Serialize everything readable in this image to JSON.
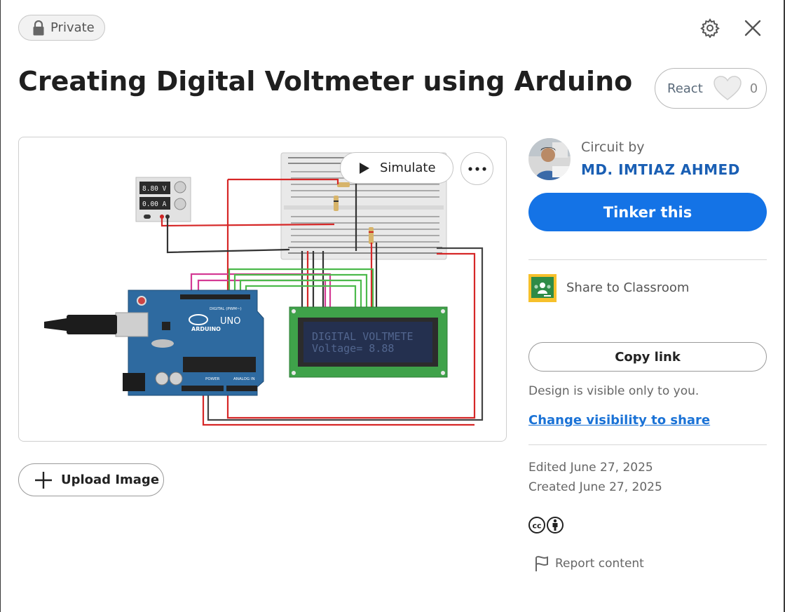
{
  "visibility_badge": {
    "label": "Private",
    "icon": "lock-icon"
  },
  "header": {
    "settings_icon": "gear-icon",
    "close_icon": "close-icon"
  },
  "design": {
    "title": "Creating Digital Voltmeter using Arduino",
    "react": {
      "label": "React",
      "count": "0",
      "icon": "heart-icon"
    }
  },
  "preview": {
    "simulate_label": "Simulate",
    "more_icon": "more-options-icon",
    "power_supply": {
      "voltage": "8.80 V",
      "current": "0.00 A"
    },
    "lcd": {
      "line1": "DIGITAL VOLTMETE",
      "line2": "Voltage= 8.88"
    },
    "arduino": {
      "brand": "ARDUINO",
      "model": "UNO",
      "digital_label": "DIGITAL (PWM~)",
      "power_label": "POWER",
      "analog_label": "ANALOG IN"
    }
  },
  "upload": {
    "label": "Upload Image",
    "icon": "plus-icon"
  },
  "author": {
    "prefix": "Circuit by",
    "name": "MD. IMTIAZ AHMED"
  },
  "actions": {
    "tinker_label": "Tinker this",
    "classroom_label": "Share to Classroom",
    "copy_link_label": "Copy link",
    "visibility_note": "Design is visible only to you.",
    "change_visibility_label": "Change visibility to share"
  },
  "meta": {
    "edited": "Edited June 27, 2025",
    "created": "Created June 27, 2025",
    "license_icon": "creative-commons-by-icon",
    "report_label": "Report content",
    "report_icon": "flag-icon"
  },
  "colors": {
    "accent": "#1473e6",
    "link": "#1a72d6",
    "author": "#1a5fb4",
    "lcd_green": "#3fa24a",
    "arduino_blue": "#2e6aa0"
  }
}
